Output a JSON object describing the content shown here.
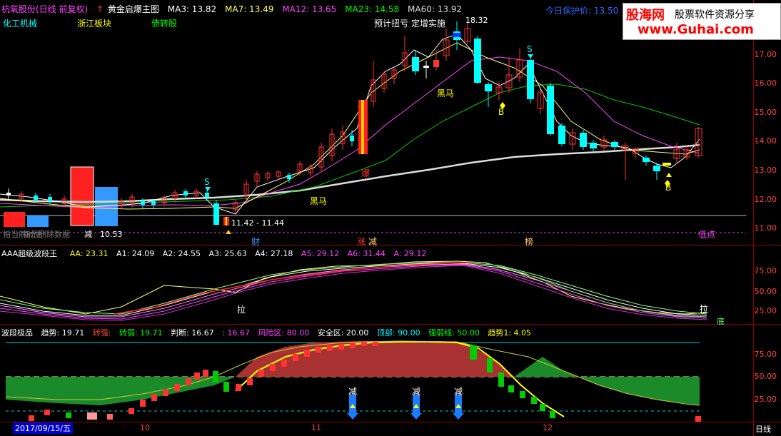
{
  "main": {
    "stock": "杭氧股份(日线 前复权)",
    "indicator": "黄金启爆主图",
    "ma": [
      {
        "label": "MA3: 13.82",
        "color": "#ffffff"
      },
      {
        "label": "MA7: 13.49",
        "color": "#ffff00"
      },
      {
        "label": "MA12: 13.65",
        "color": "#ff44ff"
      },
      {
        "label": "MA23: 14.58",
        "color": "#00ff00"
      },
      {
        "label": "MA60: 13.92",
        "color": "#dddddd"
      }
    ],
    "protect": "今日保护价: 13.50",
    "sectors": [
      "化工机械",
      "浙江板块",
      "债转股"
    ],
    "annotations": {
      "top_text": "预计扭亏",
      "top_text2": "定增实施",
      "high": "18.32",
      "heima1": "黑马",
      "heima2": "黑马",
      "low_range": "11.42 - 11.44",
      "price_low": "10.53",
      "cai": "财",
      "zhang": "涨",
      "jian": "减",
      "bang": "榜",
      "didian": "低点",
      "s1": "S",
      "s2": "S",
      "b1": "B",
      "b2": "B",
      "bao": "爆",
      "left_text": "指当前时主",
      "left_text2": "指示删除数据",
      "left_text3": "减",
      "left_low": "10.53"
    },
    "yticks": [
      "17.00",
      "16.00",
      "15.00",
      "14.00",
      "13.00",
      "12.00",
      "11.00"
    ]
  },
  "wave": {
    "title": "AAA超级波段王",
    "items": [
      {
        "label": "AA: 23.31",
        "color": "#ffff00"
      },
      {
        "label": "A1: 24.09",
        "color": "#ffffff"
      },
      {
        "label": "A2: 24.55",
        "color": "#ffffff"
      },
      {
        "label": "A3: 25.63",
        "color": "#ffffff"
      },
      {
        "label": "A4: 27.18",
        "color": "#ffffff"
      },
      {
        "label": "A5: 29.12",
        "color": "#ff44ff"
      },
      {
        "label": "A6: 31.44",
        "color": "#ff44ff"
      },
      {
        "label": "A: 29.12",
        "color": "#ff44ff"
      }
    ],
    "la1": "拉",
    "la2": "拉",
    "bottom": "底",
    "yticks": [
      "75.00",
      "50.00",
      "25.00"
    ]
  },
  "sub": {
    "title": "波段极品",
    "items": [
      {
        "label": "趋势: 19.71",
        "color": "#ffffff"
      },
      {
        "label": "转强: ",
        "color": "#ff4444"
      },
      {
        "label": "转弱: 19.71",
        "color": "#00ff00"
      },
      {
        "label": "判断: 16.67",
        "color": "#ffffff"
      },
      {
        "label": ": 16.67",
        "color": "#ff44ff"
      },
      {
        "label": "风险区: 80.00",
        "color": "#ff44ff"
      },
      {
        "label": "安全区: 20.00",
        "color": "#ffffff"
      },
      {
        "label": "顶部: 90.00",
        "color": "#00ffff"
      },
      {
        "label": "强弱线: 50.00",
        "color": "#00ff00"
      },
      {
        "label": "趋势1: 4.05",
        "color": "#ffff00"
      }
    ],
    "jian": [
      "减",
      "减",
      "减"
    ],
    "yticks": [
      "75.00",
      "50.00",
      "25.00"
    ]
  },
  "bottom": {
    "date": "2017/09/15/五",
    "months": [
      "10",
      "11",
      "12"
    ],
    "period": "日线"
  },
  "logo": {
    "name": "股海网",
    "tagline": "股票软件资源分享",
    "url": "www.Guhai.com"
  }
}
